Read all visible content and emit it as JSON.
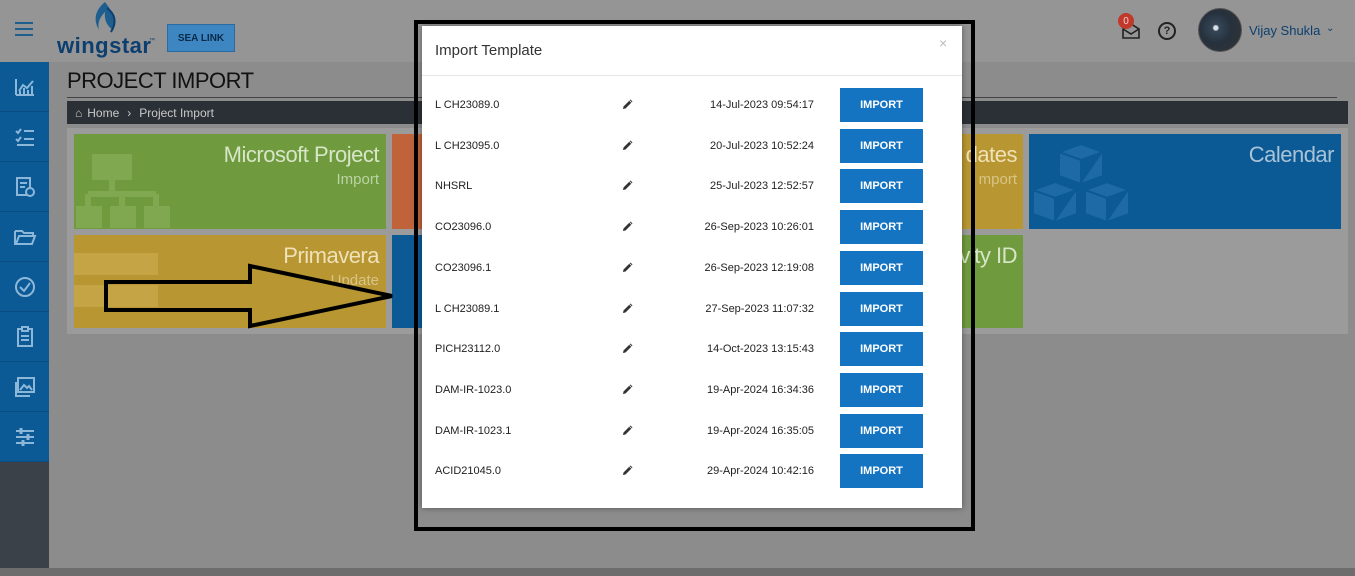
{
  "header": {
    "logo_text": "wingstar",
    "logo_tm": "™",
    "sea_link_label": "SEA LINK",
    "mail_badge": "0",
    "help_glyph": "?",
    "user_name": "Vijay Shukla",
    "user_caret": "⌄"
  },
  "sidebar": {
    "items": [
      {
        "icon": "chart-line-icon"
      },
      {
        "icon": "checklist-icon"
      },
      {
        "icon": "report-clock-icon"
      },
      {
        "icon": "folder-open-icon"
      },
      {
        "icon": "check-circle-icon"
      },
      {
        "icon": "clipboard-icon"
      },
      {
        "icon": "image-gallery-icon"
      },
      {
        "icon": "sliders-icon"
      }
    ],
    "active_index": 3
  },
  "page": {
    "title": "PROJECT IMPORT",
    "breadcrumb": {
      "home": "Home",
      "separator": "›",
      "current": "Project Import"
    }
  },
  "tiles": [
    {
      "title": "Microsoft Project",
      "subtitle": "Import",
      "color": "#6f9a3e"
    },
    {
      "title": "Primavera",
      "subtitle": "Update",
      "color": "#b89632"
    },
    {
      "title": "dates",
      "subtitle": "mport",
      "color": "#b89632"
    },
    {
      "title": "vity ID",
      "subtitle": "",
      "color": "#6f9a3e"
    },
    {
      "title": "Calendar",
      "subtitle": "",
      "color": "#0b5a96"
    }
  ],
  "modal": {
    "title": "Import Template",
    "close_glyph": "×",
    "import_label": "IMPORT",
    "rows": [
      {
        "name": "L CH23089.0",
        "date": "14-Jul-2023 09:54:17"
      },
      {
        "name": "L CH23095.0",
        "date": "20-Jul-2023 10:52:24"
      },
      {
        "name": "NHSRL",
        "date": "25-Jul-2023 12:52:57"
      },
      {
        "name": "CO23096.0",
        "date": "26-Sep-2023 10:26:01"
      },
      {
        "name": "CO23096.1",
        "date": "26-Sep-2023 12:19:08"
      },
      {
        "name": "L CH23089.1",
        "date": "27-Sep-2023 11:07:32"
      },
      {
        "name": "PICH23112.0",
        "date": "14-Oct-2023 13:15:43"
      },
      {
        "name": "DAM-IR-1023.0",
        "date": "19-Apr-2024 16:34:36"
      },
      {
        "name": "DAM-IR-1023.1",
        "date": "19-Apr-2024 16:35:05"
      },
      {
        "name": "ACID21045.0",
        "date": "29-Apr-2024 10:42:16"
      }
    ]
  },
  "colors": {
    "primary": "#1474c2",
    "sidebar": "#0b5a96",
    "badge": "#c0392b",
    "annotation": "#000000"
  }
}
